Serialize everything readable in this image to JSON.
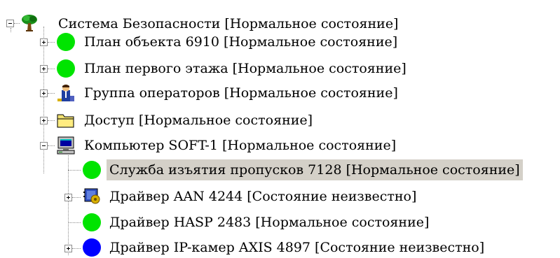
{
  "tree": {
    "root": {
      "label": "Система Безопасности [Нормальное состояние]",
      "icon": "tree-icon",
      "expanded": true
    },
    "items": [
      {
        "label": "План объекта 6910 [Нормальное состояние]",
        "icon": "green-circle-icon",
        "expanded": false
      },
      {
        "label": "План первого этажа [Нормальное состояние]",
        "icon": "green-circle-icon",
        "expanded": false
      },
      {
        "label": "Группа операторов [Нормальное состояние]",
        "icon": "operators-group-icon",
        "expanded": false
      },
      {
        "label": "Доступ [Нормальное состояние]",
        "icon": "folder-icon",
        "expanded": false
      },
      {
        "label": "Компьютер SOFT-1 [Нормальное состояние]",
        "icon": "computer-icon",
        "expanded": true,
        "children": [
          {
            "label": "Служба изъятия пропусков 7128 [Нормальное состояние]",
            "icon": "green-circle-icon",
            "selected": true
          },
          {
            "label": "Драйвер AAN 4244 [Состояние неизвестно]",
            "icon": "driver-icon",
            "expanded": false
          },
          {
            "label": "Драйвер HASP 2483 [Нормальное состояние]",
            "icon": "green-circle-icon"
          },
          {
            "label": "Драйвер IP-камер AXIS 4897 [Состояние неизвестно]",
            "icon": "blue-circle-icon",
            "expanded": false
          }
        ]
      }
    ]
  },
  "colors": {
    "status_normal": "#00e400",
    "status_unknown": "#0000ff",
    "selection_background": "#d4d0c8",
    "tree_lines": "#8c8c8c"
  }
}
